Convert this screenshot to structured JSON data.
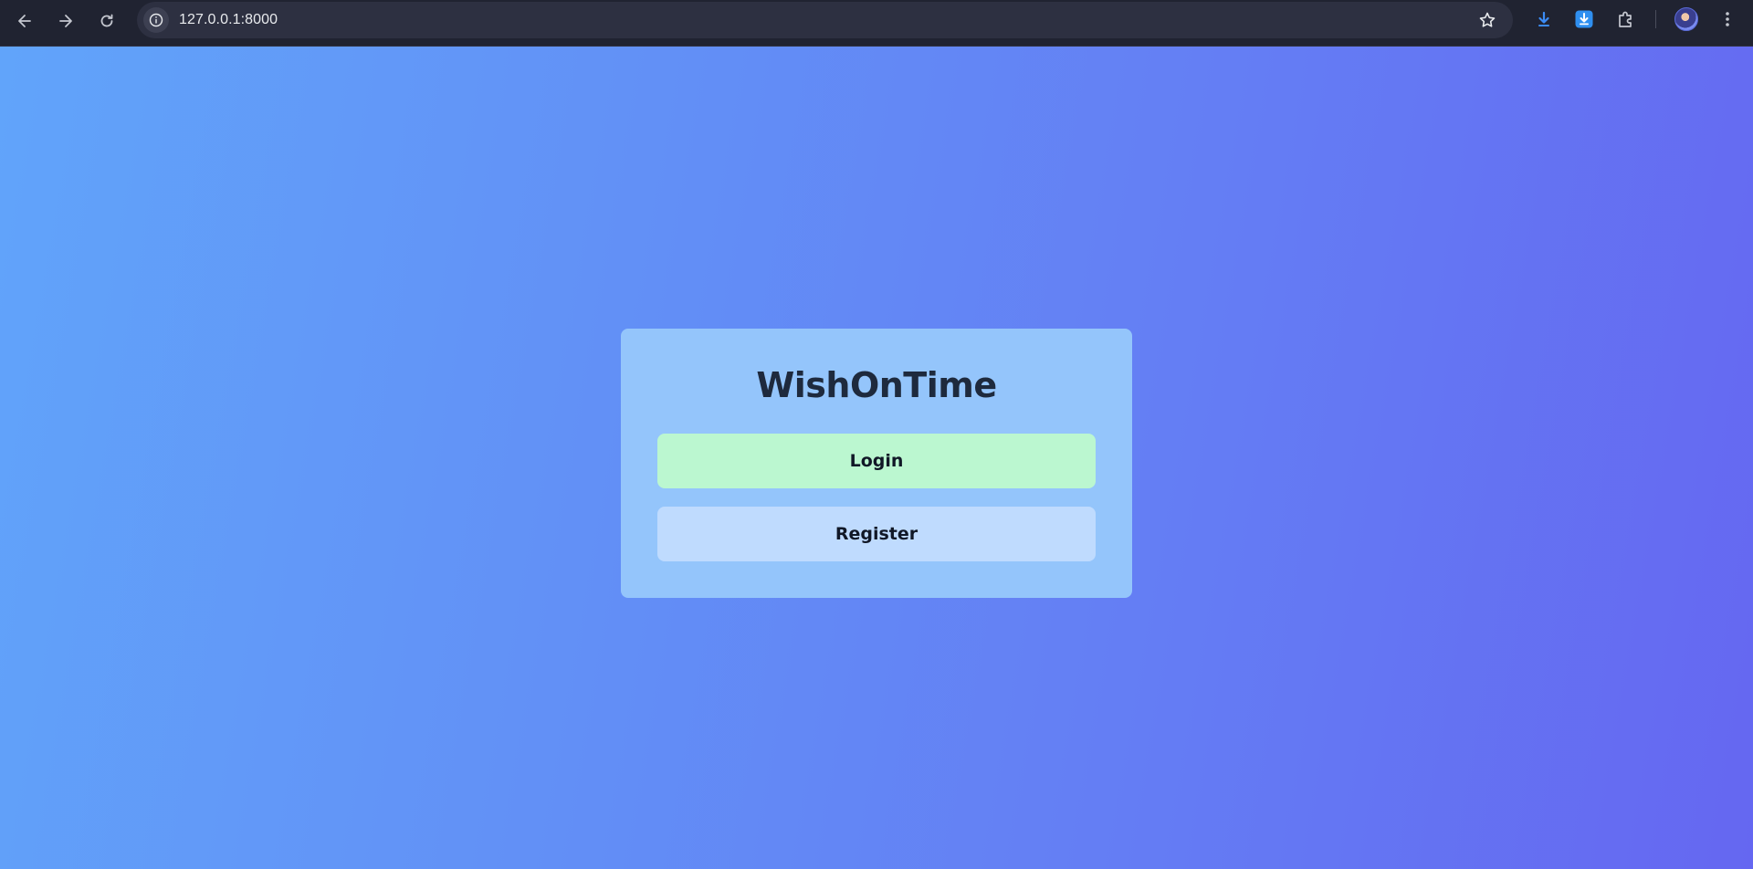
{
  "browser": {
    "url": "127.0.0.1:8000"
  },
  "main": {
    "title": "WishOnTime",
    "login_label": "Login",
    "register_label": "Register"
  },
  "colors": {
    "card_bg": "#94c5fb",
    "login_bg": "#bbf7d0",
    "register_bg": "#bfdbfe",
    "gradient_start": "#61a4fa",
    "gradient_end": "#6567f1"
  }
}
